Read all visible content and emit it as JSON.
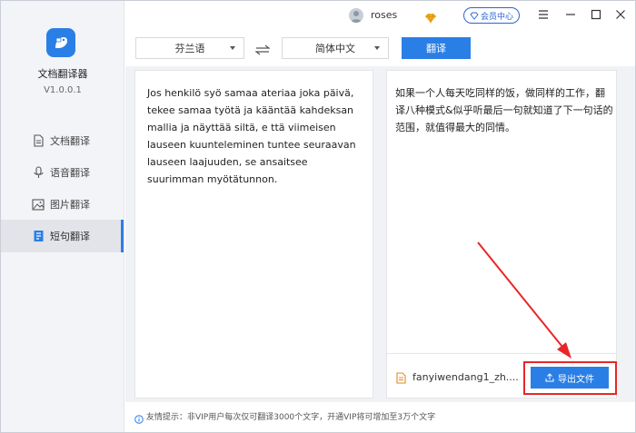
{
  "app": {
    "name": "文档翻译器",
    "version": "V1.0.0.1"
  },
  "sidebar": {
    "items": [
      {
        "label": "文档翻译",
        "icon": "document-icon",
        "active": false
      },
      {
        "label": "语音翻译",
        "icon": "microphone-icon",
        "active": false
      },
      {
        "label": "图片翻译",
        "icon": "image-icon",
        "active": false
      },
      {
        "label": "短句翻译",
        "icon": "text-doc-icon",
        "active": true
      }
    ]
  },
  "titlebar": {
    "username": "roses",
    "member_label": "会员中心"
  },
  "translate_bar": {
    "source_lang": "芬兰语",
    "target_lang": "简体中文",
    "translate_label": "翻译"
  },
  "source": {
    "text": "Jos henkilö syö samaa ateriaa joka päivä, tekee samaa työtä ja kääntää kahdeksan mallia ja näyttää siltä, e        ttä viimeisen lauseen kuunteleminen tuntee seuraavan lauseen laajuuden, se ansaitsee suurimman myötätunnon."
  },
  "result": {
    "text": "如果一个人每天吃同样的饭，做同样的工作，翻译八种模式&似乎听最后一句就知道了下一句话的范围，就值得最大的同情。",
    "file_name": "fanyiwendang1_zh....",
    "export_label": "导出文件"
  },
  "footer": {
    "notice": "友情提示：非VIP用户每次仅可翻译3000个文字，开通VIP将可增加至3万个文字"
  },
  "colors": {
    "accent": "#2a7fe6",
    "highlight": "#e8262a"
  }
}
